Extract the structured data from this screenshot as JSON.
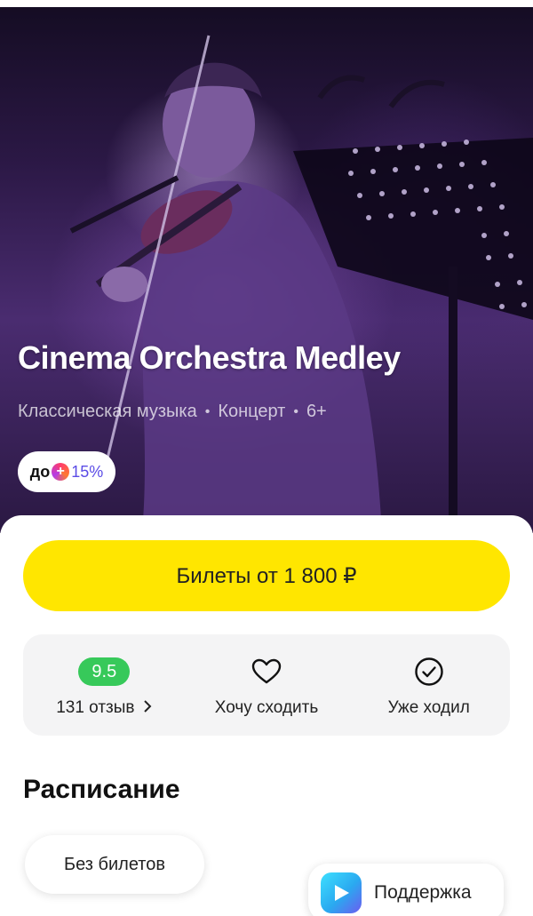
{
  "event": {
    "title": "Cinema Orchestra Medley",
    "genre": "Классическая музыка",
    "type": "Концерт",
    "age": "6+",
    "promo": {
      "prefix": "до",
      "icon": "plus-icon",
      "value": "15%"
    }
  },
  "tickets": {
    "label": "Билеты от 1 800 ₽",
    "color": "#ffe600"
  },
  "actions": {
    "rating": {
      "score": "9.5",
      "reviews_label": "131 отзыв",
      "chevron": "›",
      "badge_color": "#37c95a"
    },
    "want": {
      "label": "Хочу сходить",
      "icon": "heart-icon"
    },
    "visited": {
      "label": "Уже ходил",
      "icon": "check-circle-icon"
    }
  },
  "schedule": {
    "title": "Расписание",
    "chips": [
      "Без билетов"
    ]
  },
  "support": {
    "label": "Поддержка",
    "icon": "support-play-icon"
  }
}
